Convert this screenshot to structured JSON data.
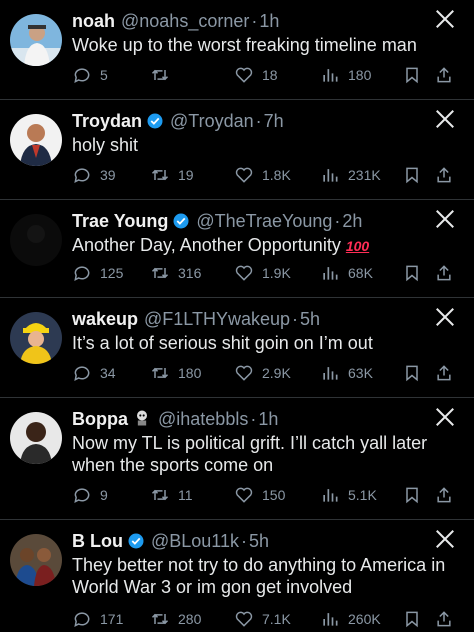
{
  "posts": [
    {
      "name": "noah",
      "handle": "@noahs_corner",
      "time": "1h",
      "verified": false,
      "text": "Woke up to the worst freaking timeline man",
      "replies": "5",
      "reposts": "",
      "likes": "18",
      "views": "180",
      "avatar": "avatar-noah"
    },
    {
      "name": "Troydan",
      "handle": "@Troydan",
      "time": "7h",
      "verified": true,
      "text": "holy shit",
      "replies": "39",
      "reposts": "19",
      "likes": "1.8K",
      "views": "231K",
      "avatar": "avatar-troydan"
    },
    {
      "name": "Trae Young",
      "handle": "@TheTraeYoung",
      "time": "2h",
      "verified": true,
      "text": "Another Day, Another Opportunity",
      "emoji": "100",
      "replies": "125",
      "reposts": "316",
      "likes": "1.9K",
      "views": "68K",
      "avatar": "avatar-trae"
    },
    {
      "name": "wakeup",
      "handle": "@F1LTHYwakeup",
      "time": "5h",
      "verified": false,
      "text": "It’s a lot of serious shit goin on I’m out",
      "replies": "34",
      "reposts": "180",
      "likes": "2.9K",
      "views": "63K",
      "avatar": "avatar-wakeup"
    },
    {
      "name": "Boppa",
      "handle": "@ihatebbls",
      "time": "1h",
      "verified": false,
      "text": "Now my TL is political grift. I’ll catch yall later when the sports come on",
      "replies": "9",
      "reposts": "11",
      "likes": "150",
      "views": "5.1K",
      "avatar": "avatar-boppa"
    },
    {
      "name": "B Lou",
      "handle": "@BLou11k",
      "time": "5h",
      "verified": true,
      "text": "They better not try to do anything to America in World War 3 or im gon get involved",
      "replies": "171",
      "reposts": "280",
      "likes": "7.1K",
      "views": "260K",
      "avatar": "avatar-blou"
    }
  ],
  "separator": "·",
  "colors": {
    "background": "#000000",
    "text": "#e7e9ea",
    "muted": "#8b98a5",
    "verified": "#1d9bf0",
    "divider": "#2f3336"
  },
  "icons": [
    "reply-icon",
    "repost-icon",
    "like-icon",
    "views-icon",
    "bookmark-icon",
    "share-icon",
    "x-logo-icon",
    "verified-badge-icon"
  ]
}
